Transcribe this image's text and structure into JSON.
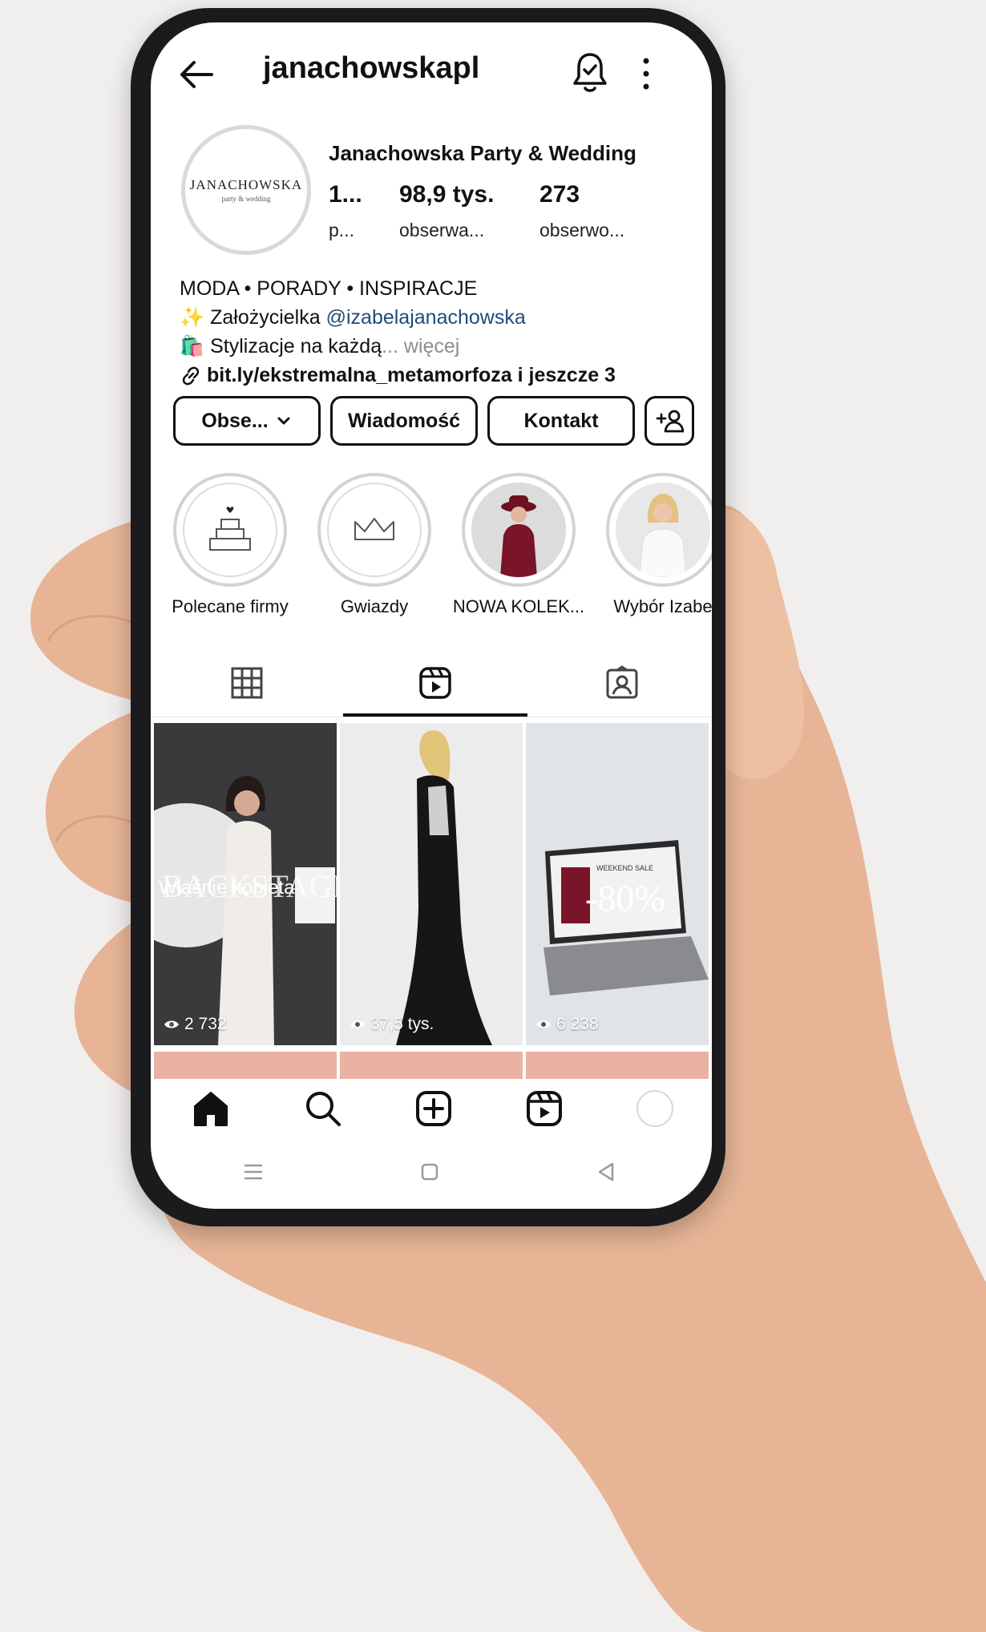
{
  "header": {
    "username": "janachowskapl"
  },
  "profile": {
    "avatar_logo": "JANACHOWSKA",
    "avatar_tagline": "party & wedding",
    "display_name": "Janachowska Party & Wedding",
    "stats": [
      {
        "value": "1...",
        "label": "p..."
      },
      {
        "value": "98,9 tys.",
        "label": "obserwa..."
      },
      {
        "value": "273",
        "label": "obserwo..."
      }
    ]
  },
  "bio": {
    "line1": "MODA • PORADY • INSPIRACJE",
    "line2_emoji": "✨",
    "line2_text": "Założycielka",
    "line2_mention": "@izabelajanachowska",
    "line3_emoji": "🛍️",
    "line3_text": "Stylizacje na każdą",
    "line3_more": "... więcej",
    "link": "bit.ly/ekstremalna_metamorfoza i jeszcze 3"
  },
  "buttons": {
    "follow": "Obse...",
    "message": "Wiadomość",
    "contact": "Kontakt"
  },
  "highlights": [
    {
      "label": "Polecane firmy"
    },
    {
      "label": "Gwiazdy"
    },
    {
      "label": "NOWA KOLEK..."
    },
    {
      "label": "Wybór Izabe"
    }
  ],
  "reels": [
    {
      "views": "2 732",
      "overlay_big": "BACKSTAGE",
      "overlay_small": "Właśnie kobieta"
    },
    {
      "views": "37,5 tys."
    },
    {
      "views": "6 238",
      "overlay_big": "-80%",
      "overlay_small": "WEEKEND SALE"
    }
  ],
  "colors": {
    "accent_link": "#1f4c7a",
    "strip": "#e9b2a2",
    "background": "#f1eeee"
  }
}
